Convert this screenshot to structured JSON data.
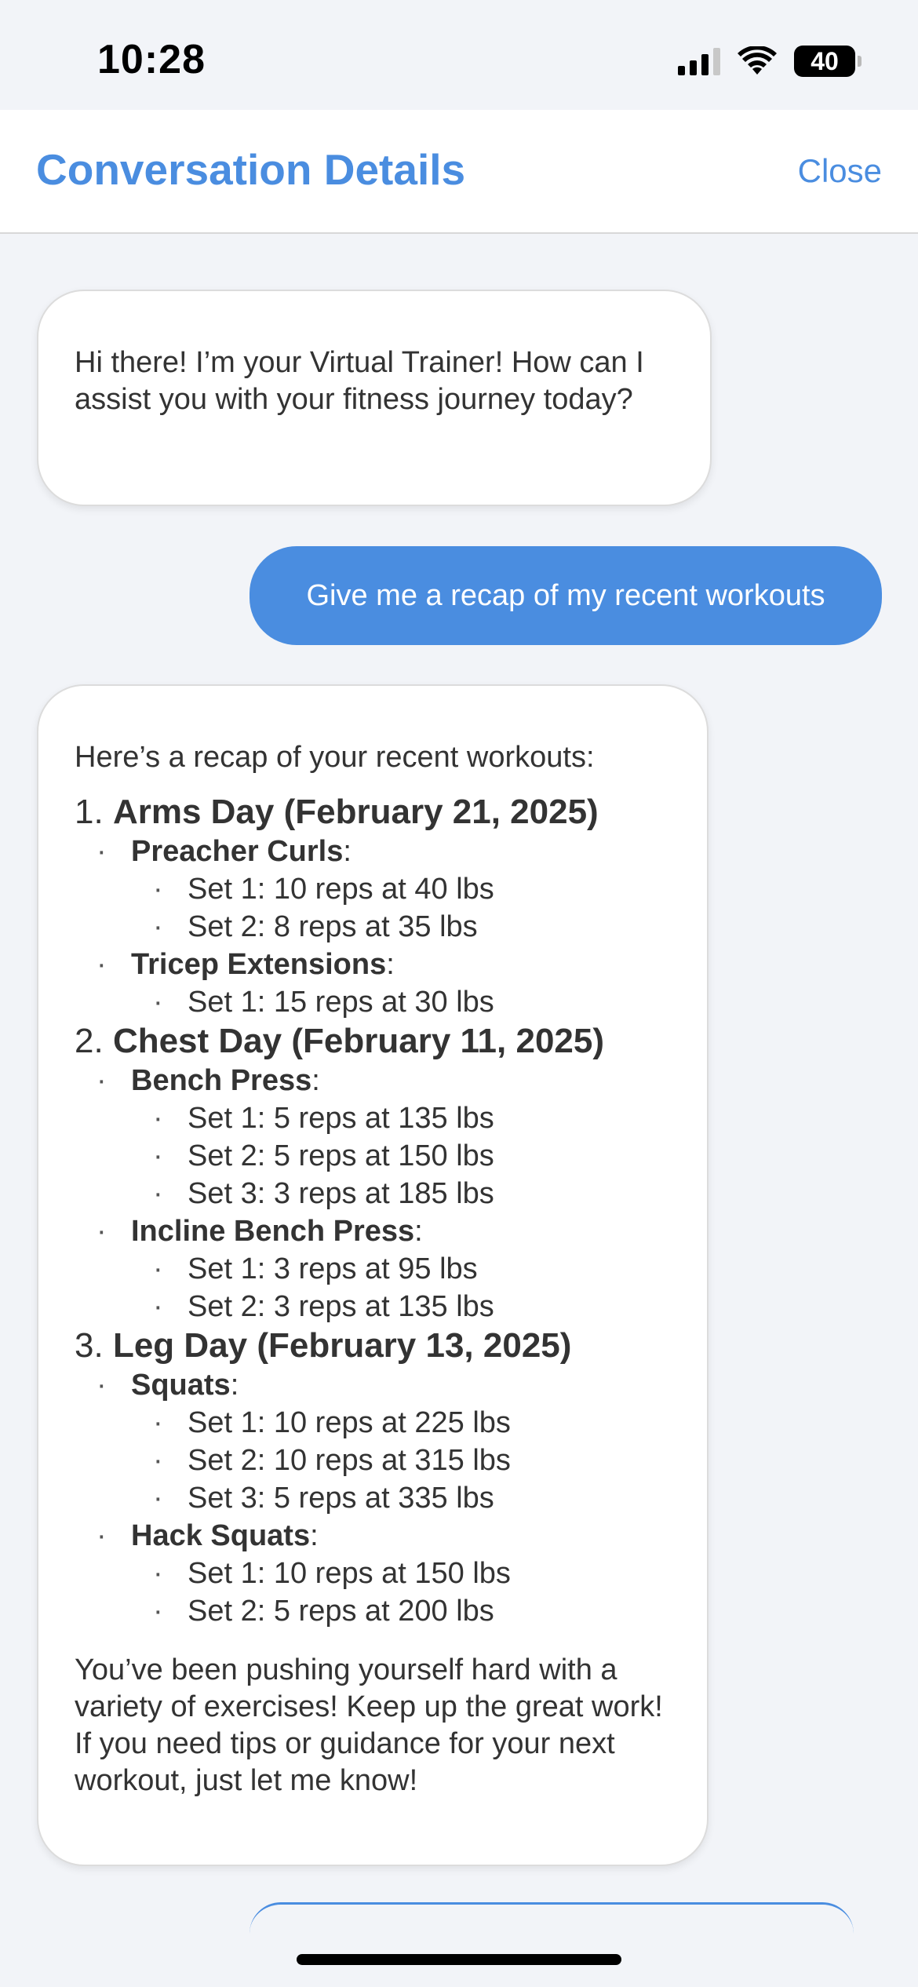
{
  "status_bar": {
    "time": "10:28",
    "battery": "40"
  },
  "header": {
    "title": "Conversation Details",
    "close_label": "Close"
  },
  "messages": {
    "bot_greeting": "Hi there! I’m your Virtual Trainer! How can I assist you with your fitness journey today?",
    "user_request": "Give me a recap of my recent workouts",
    "recap": {
      "intro": "Here’s a recap of your recent workouts:",
      "days": [
        {
          "number": "1.",
          "title": "Arms Day (February 21, 2025)",
          "exercises": [
            {
              "name": "Preacher Curls",
              "sets": [
                "Set 1: 10 reps at 40 lbs",
                "Set 2: 8 reps at 35 lbs"
              ]
            },
            {
              "name": "Tricep Extensions",
              "sets": [
                "Set 1: 15 reps at 30 lbs"
              ]
            }
          ]
        },
        {
          "number": "2.",
          "title": "Chest Day (February 11, 2025)",
          "exercises": [
            {
              "name": "Bench Press",
              "sets": [
                "Set 1: 5 reps at 135 lbs",
                "Set 2: 5 reps at 150 lbs",
                "Set 3: 3 reps at 185 lbs"
              ]
            },
            {
              "name": "Incline Bench Press",
              "sets": [
                "Set 1: 3 reps at 95 lbs",
                "Set 2: 3 reps at 135 lbs"
              ]
            }
          ]
        },
        {
          "number": "3.",
          "title": "Leg Day (February 13, 2025)",
          "exercises": [
            {
              "name": "Squats",
              "sets": [
                "Set 1: 10 reps at 225 lbs",
                "Set 2: 10 reps at 315 lbs",
                "Set 3: 5 reps at 335 lbs"
              ]
            },
            {
              "name": "Hack Squats",
              "sets": [
                "Set 1: 10 reps at 150 lbs",
                "Set 2: 5 reps at 200 lbs"
              ]
            }
          ]
        }
      ],
      "outro": "You’ve been pushing yourself hard with a variety of exercises! Keep up the great work! If you need tips or guidance for your next workout, just let me know!"
    }
  },
  "colors": {
    "accent": "#4a8de0",
    "background": "#f2f4f8"
  }
}
